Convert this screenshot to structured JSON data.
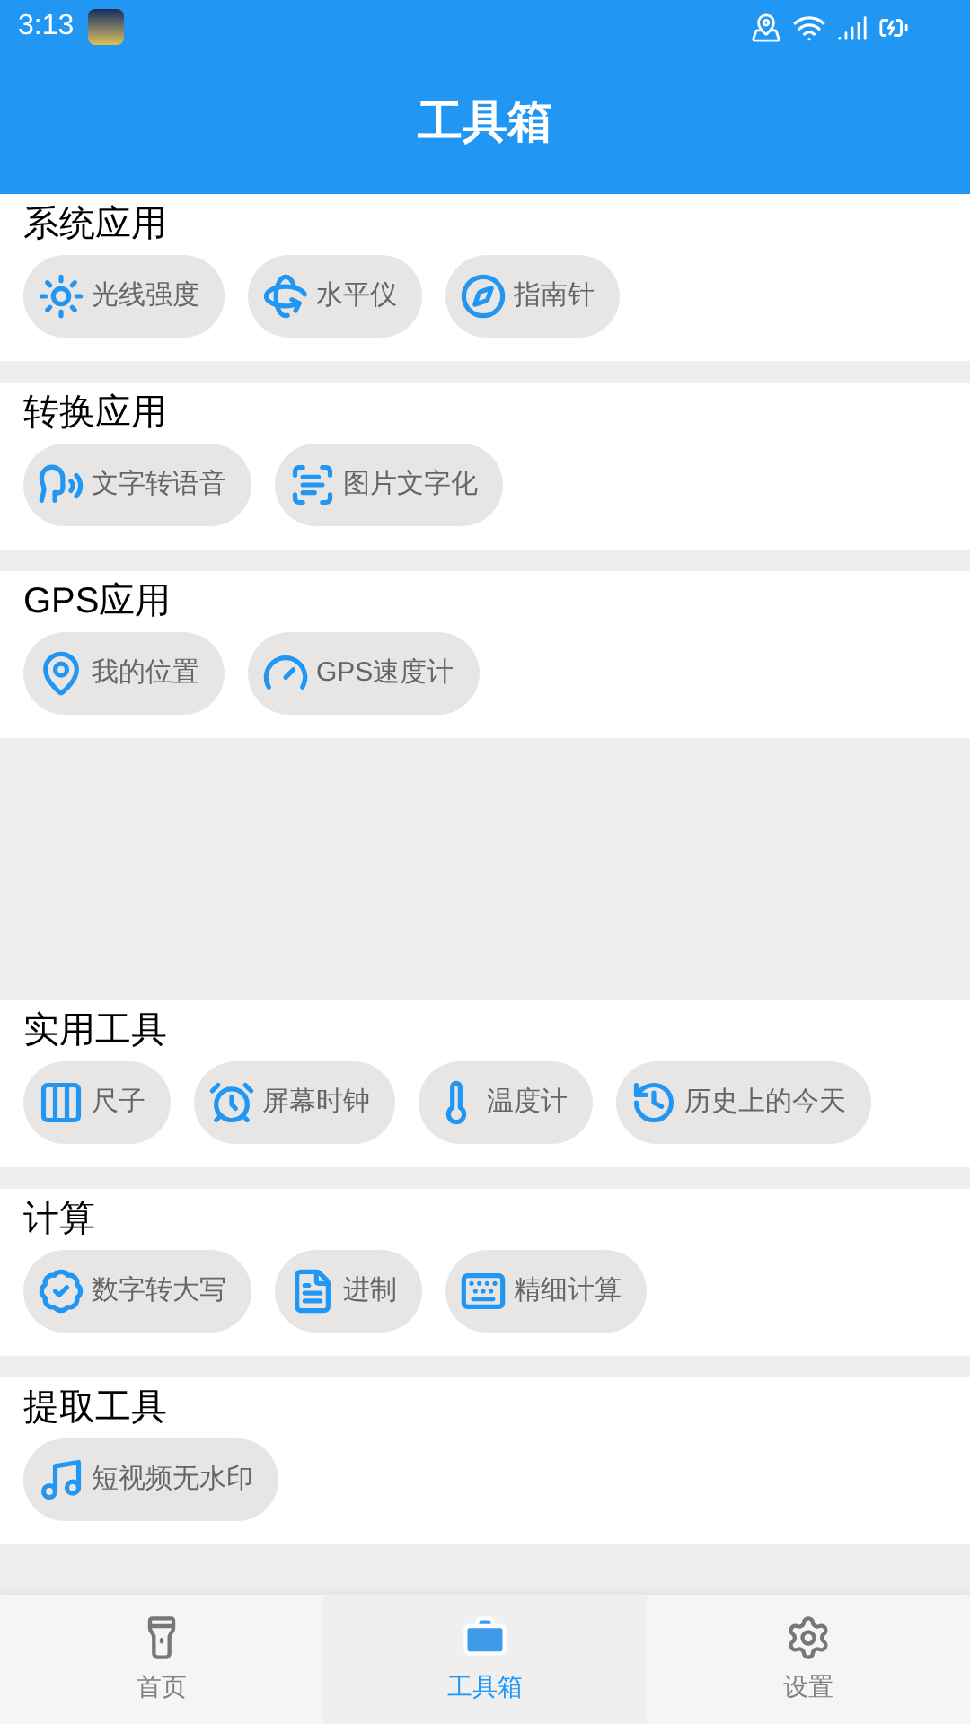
{
  "status_bar": {
    "time": "3:13"
  },
  "header": {
    "title": "工具箱"
  },
  "sections": [
    {
      "title": "系统应用",
      "tools": [
        {
          "label": "光线强度"
        },
        {
          "label": "水平仪"
        },
        {
          "label": "指南针"
        }
      ]
    },
    {
      "title": "转换应用",
      "tools": [
        {
          "label": "文字转语音"
        },
        {
          "label": "图片文字化"
        }
      ]
    },
    {
      "title": "GPS应用",
      "tools": [
        {
          "label": "我的位置"
        },
        {
          "label": "GPS速度计"
        }
      ]
    },
    {
      "title": "实用工具",
      "tools": [
        {
          "label": "尺子"
        },
        {
          "label": "屏幕时钟"
        },
        {
          "label": "温度计"
        },
        {
          "label": "历史上的今天"
        }
      ]
    },
    {
      "title": "计算",
      "tools": [
        {
          "label": "数字转大写"
        },
        {
          "label": "进制"
        },
        {
          "label": "精细计算"
        }
      ]
    },
    {
      "title": "提取工具",
      "tools": [
        {
          "label": "短视频无水印"
        }
      ]
    }
  ],
  "bottom_nav": [
    {
      "label": "首页",
      "selected": false
    },
    {
      "label": "工具箱",
      "selected": true
    },
    {
      "label": "设置",
      "selected": false
    }
  ]
}
